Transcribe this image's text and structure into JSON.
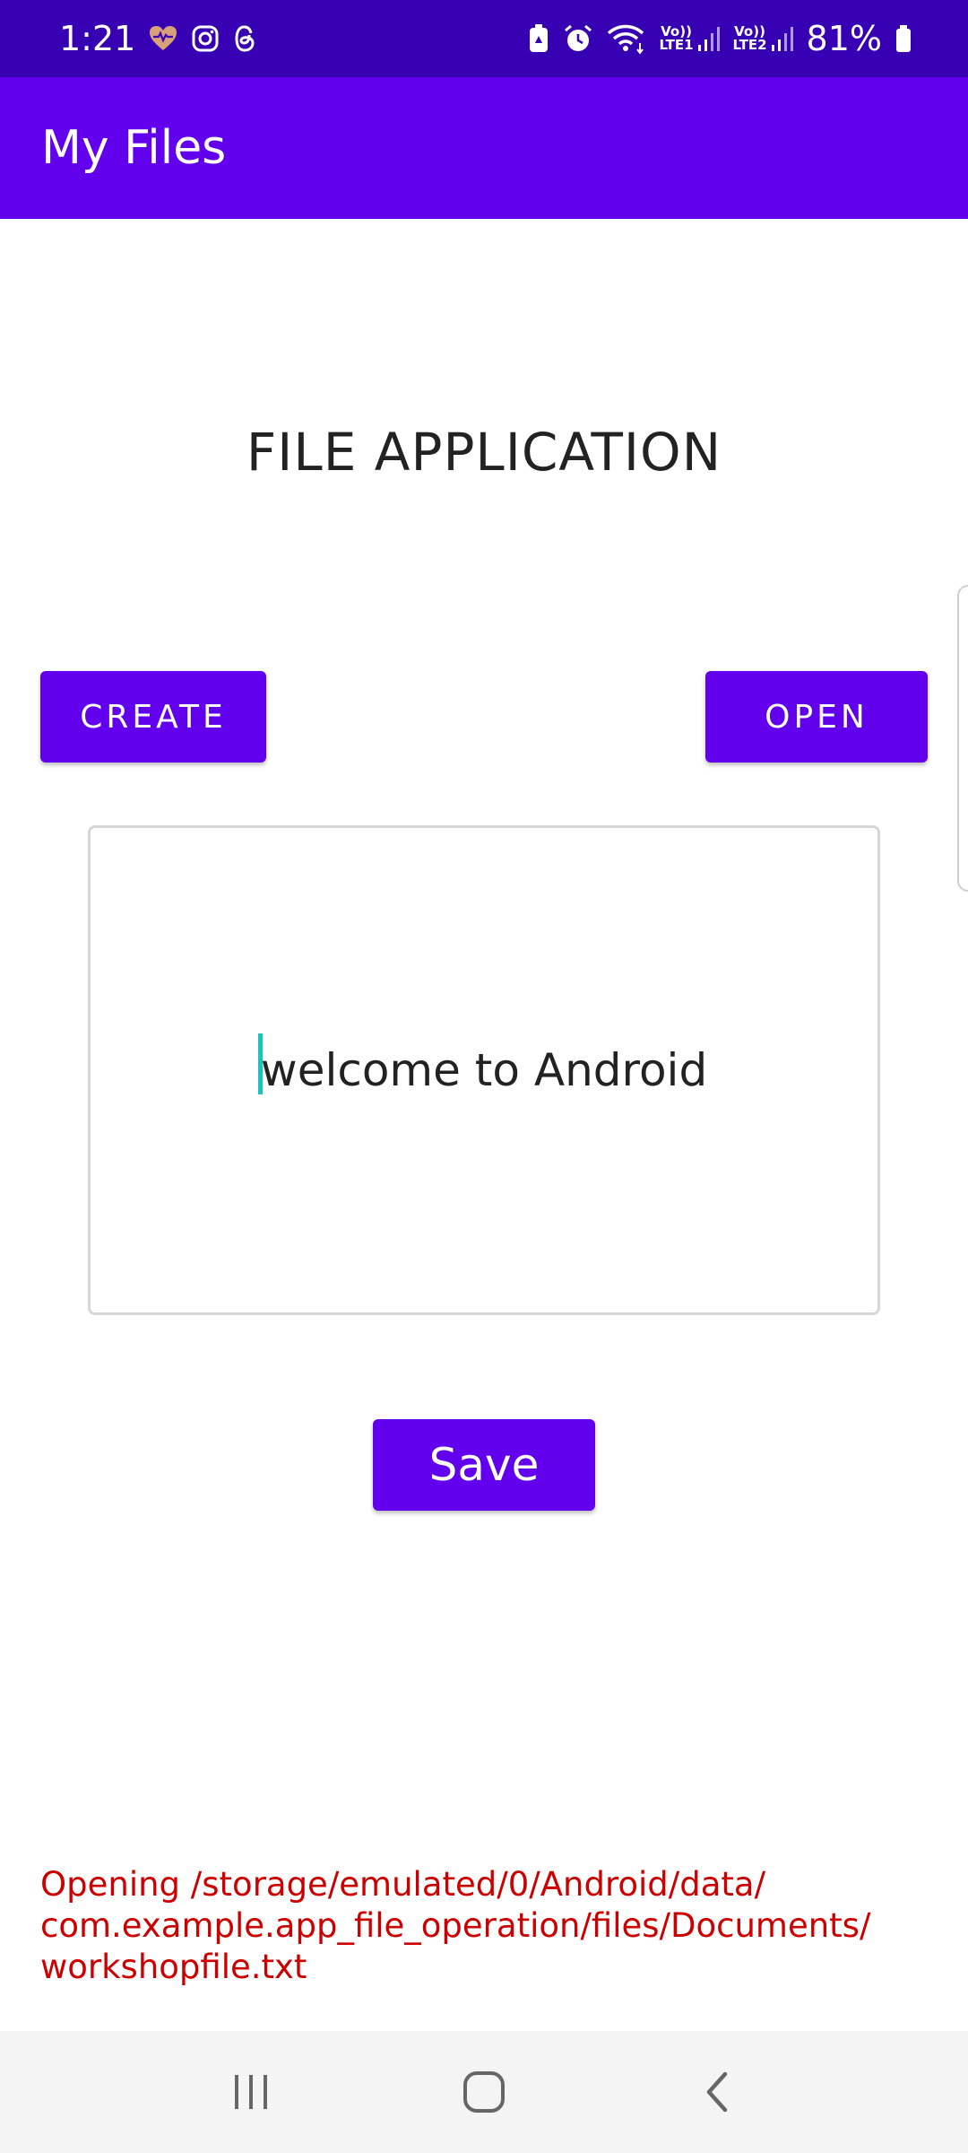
{
  "status_bar": {
    "time": "1:21",
    "battery_percent": "81%",
    "left_icons": [
      "health-heart-icon",
      "instagram-icon",
      "threads-icon"
    ],
    "right_icons": [
      "battery-saver-icon",
      "alarm-icon",
      "wifi-icon",
      "volte-lte1-signal-icon",
      "volte-lte2-signal-icon",
      "battery-icon"
    ],
    "sim1_label": "LTE1",
    "sim2_label": "LTE2",
    "volte_label": "Vo))"
  },
  "app_bar": {
    "title": "My Files",
    "color": "#6200ee"
  },
  "main": {
    "heading": "FILE APPLICATION",
    "create_label": "CREATE",
    "open_label": "OPEN",
    "editor_value": "welcome to Android",
    "save_label": "Save",
    "status_message": "Opening /storage/emulated/0/Android/data/\ncom.example.app_file_operation/files/Documents/\nworkshopfile.txt",
    "status_color": "#cc0000"
  },
  "nav_bar": {
    "items": [
      "recent-apps-icon",
      "home-icon",
      "back-icon"
    ]
  }
}
